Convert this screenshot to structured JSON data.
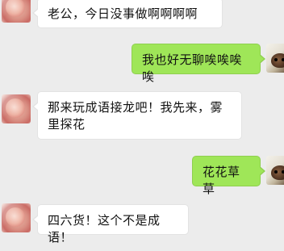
{
  "messages": [
    {
      "sender": "other",
      "text": "老公，今日没事做啊啊啊啊"
    },
    {
      "sender": "self",
      "text": "我也好无聊唉唉唉唉"
    },
    {
      "sender": "other",
      "text": "那来玩成语接龙吧！我先来，雾里探花"
    },
    {
      "sender": "self",
      "text": "花花草草"
    },
    {
      "sender": "other",
      "text": "四六货！这个不是成语！"
    }
  ],
  "colors": {
    "background": "#ececec",
    "incoming_bubble": "#ffffff",
    "outgoing_bubble": "#9fe658"
  }
}
